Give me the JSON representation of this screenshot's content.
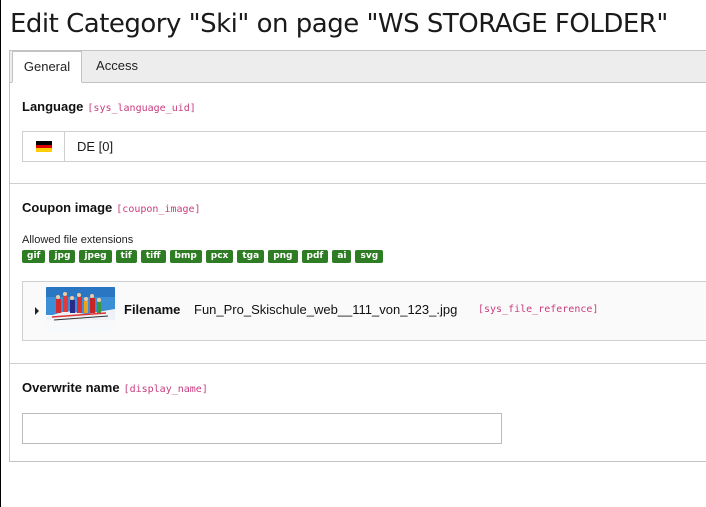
{
  "page": {
    "title": "Edit Category \"Ski\" on page \"WS STORAGE FOLDER\""
  },
  "tabs": [
    {
      "label": "General",
      "active": true
    },
    {
      "label": "Access",
      "active": false
    }
  ],
  "fields": {
    "language": {
      "label": "Language",
      "key": "[sys_language_uid]",
      "value": "DE [0]",
      "flag": "de-flag-icon"
    },
    "coupon_image": {
      "label": "Coupon image",
      "key": "[coupon_image]",
      "allowed_caption": "Allowed file extensions",
      "extensions": [
        "gif",
        "jpg",
        "jpeg",
        "tif",
        "tiff",
        "bmp",
        "pcx",
        "tga",
        "png",
        "pdf",
        "ai",
        "svg"
      ],
      "file": {
        "filename_label": "Filename",
        "filename": "Fun_Pro_Skischule_web__111_von_123_.jpg",
        "key": "[sys_file_reference]"
      }
    },
    "overwrite_name": {
      "label": "Overwrite name",
      "key": "[display_name]",
      "value": ""
    }
  },
  "colors": {
    "badge": "#2e7d24",
    "field_key": "#c83c7e",
    "tab_bar": "#ededed"
  }
}
